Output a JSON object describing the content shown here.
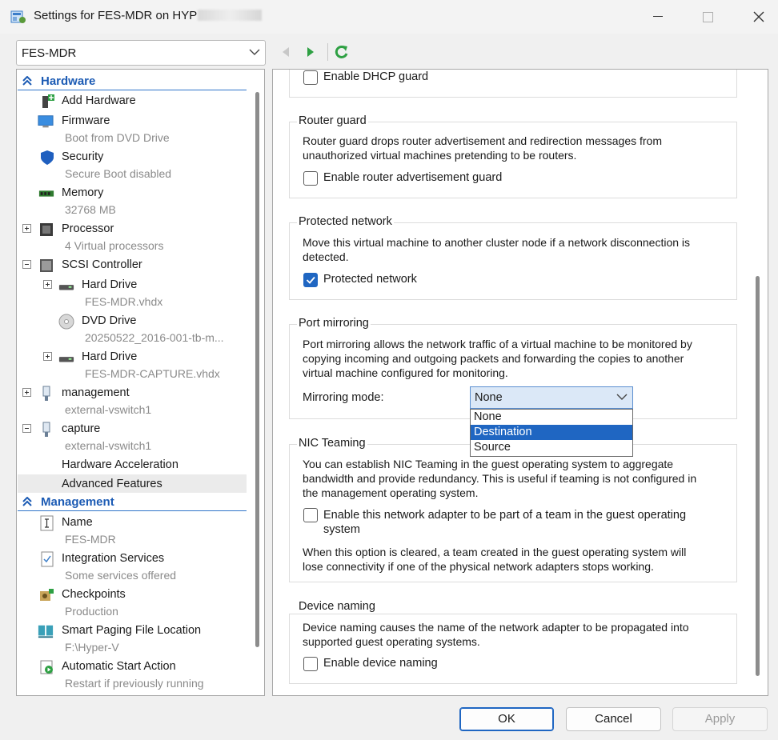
{
  "window": {
    "title": "Settings for FES-MDR on HYP"
  },
  "vm_selector": {
    "value": "FES-MDR"
  },
  "sidebar": {
    "hardware_header": "Hardware",
    "management_header": "Management",
    "items": [
      {
        "label": "Add Hardware",
        "sub": ""
      },
      {
        "label": "Firmware",
        "sub": "Boot from DVD Drive"
      },
      {
        "label": "Security",
        "sub": "Secure Boot disabled"
      },
      {
        "label": "Memory",
        "sub": "32768 MB"
      },
      {
        "label": "Processor",
        "sub": "4 Virtual processors"
      },
      {
        "label": "SCSI Controller",
        "sub": ""
      },
      {
        "label": "Hard Drive",
        "sub": "FES-MDR.vhdx"
      },
      {
        "label": "DVD Drive",
        "sub": "20250522_2016-001-tb-m..."
      },
      {
        "label": "Hard Drive",
        "sub": "FES-MDR-CAPTURE.vhdx"
      },
      {
        "label": "management",
        "sub": "external-vswitch1"
      },
      {
        "label": "capture",
        "sub": "external-vswitch1"
      },
      {
        "label": "Hardware Acceleration",
        "sub": ""
      },
      {
        "label": "Advanced Features",
        "sub": ""
      }
    ],
    "management_items": [
      {
        "label": "Name",
        "sub": "FES-MDR"
      },
      {
        "label": "Integration Services",
        "sub": "Some services offered"
      },
      {
        "label": "Checkpoints",
        "sub": "Production"
      },
      {
        "label": "Smart Paging File Location",
        "sub": "F:\\Hyper-V"
      },
      {
        "label": "Automatic Start Action",
        "sub": "Restart if previously running"
      }
    ]
  },
  "main": {
    "dhcp_guard": {
      "label": "Enable DHCP guard",
      "checked": false
    },
    "router_guard": {
      "title": "Router guard",
      "desc_line1": "Router guard drops router advertisement and redirection messages from",
      "desc_line2": "unauthorized virtual machines pretending to be routers.",
      "checkbox_label": "Enable router advertisement guard",
      "checked": false
    },
    "protected_network": {
      "title": "Protected network",
      "desc_line1": "Move this virtual machine to another cluster node if a network disconnection is",
      "desc_line2": "detected.",
      "checkbox_label": "Protected network",
      "checked": true
    },
    "port_mirroring": {
      "title": "Port mirroring",
      "desc_line1": "Port mirroring allows the network traffic of a virtual machine to be monitored by",
      "desc_line2": "copying incoming and outgoing packets and forwarding the copies to another",
      "desc_line3": "virtual machine configured for monitoring.",
      "mode_label": "Mirroring mode:",
      "mode_value": "None",
      "options": [
        "None",
        "Destination",
        "Source"
      ],
      "highlighted_option": "Destination"
    },
    "nic_teaming": {
      "title": "NIC Teaming",
      "desc_line1": "You can establish NIC Teaming in the guest operating system to aggregate",
      "desc_line2": "bandwidth and provide redundancy. This is useful if teaming is not configured in",
      "desc_line3": "the management operating system.",
      "checkbox_label_line1": "Enable this network adapter to be part of a team in the guest operating",
      "checkbox_label_line2": "system",
      "checked": false,
      "note_line1": "When this option is cleared, a team created in the guest operating system will",
      "note_line2": "lose connectivity if one of the physical network adapters stops working."
    },
    "device_naming": {
      "title": "Device naming",
      "desc_line1": "Device naming causes the name of the network adapter to be propagated into",
      "desc_line2": "supported guest operating systems.",
      "checkbox_label": "Enable device naming",
      "checked": false
    }
  },
  "footer": {
    "ok": "OK",
    "cancel": "Cancel",
    "apply": "Apply"
  },
  "colors": {
    "accent": "#1f66c2",
    "header_text": "#1c5bb4",
    "sub_text": "#8a8a8a"
  }
}
